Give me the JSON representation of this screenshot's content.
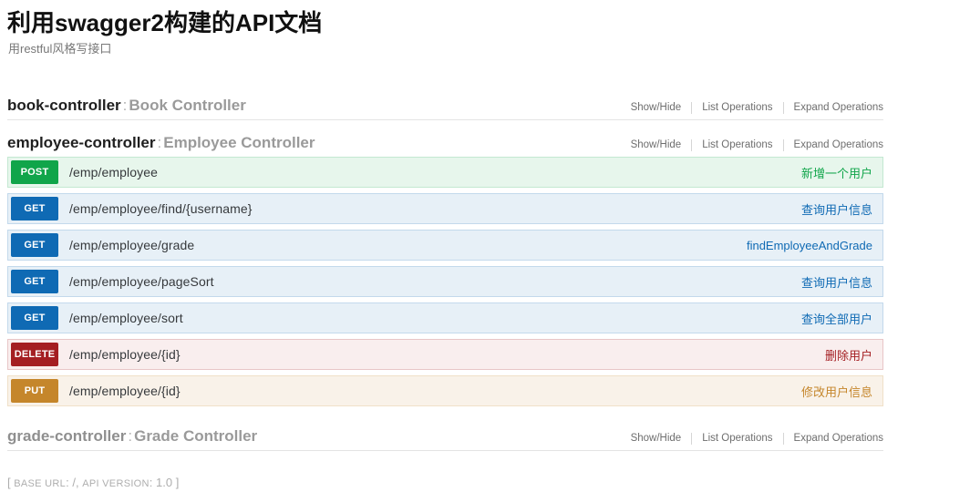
{
  "header": {
    "title": "利用swagger2构建的API文档",
    "subtitle": "用restful风格写接口"
  },
  "options_labels": {
    "show_hide": "Show/Hide",
    "list_operations": "List Operations",
    "expand_operations": "Expand Operations"
  },
  "resources": [
    {
      "name": "book-controller",
      "separator": ":",
      "description": "Book Controller",
      "show_hide": "Show/Hide",
      "list_operations": "List Operations",
      "expand_operations": "Expand Operations",
      "operations": []
    },
    {
      "name": "employee-controller",
      "separator": ":",
      "description": "Employee Controller",
      "show_hide": "Show/Hide",
      "list_operations": "List Operations",
      "expand_operations": "Expand Operations",
      "operations": [
        {
          "method": "POST",
          "path": "/emp/employee",
          "summary": "新增一个用户"
        },
        {
          "method": "GET",
          "path": "/emp/employee/find/{username}",
          "summary": "查询用户信息"
        },
        {
          "method": "GET",
          "path": "/emp/employee/grade",
          "summary": "findEmployeeAndGrade"
        },
        {
          "method": "GET",
          "path": "/emp/employee/pageSort",
          "summary": "查询用户信息"
        },
        {
          "method": "GET",
          "path": "/emp/employee/sort",
          "summary": "查询全部用户"
        },
        {
          "method": "DELETE",
          "path": "/emp/employee/{id}",
          "summary": "删除用户"
        },
        {
          "method": "PUT",
          "path": "/emp/employee/{id}",
          "summary": "修改用户信息"
        }
      ]
    },
    {
      "name": "grade-controller",
      "separator": ":",
      "description": "Grade Controller",
      "show_hide": "Show/Hide",
      "list_operations": "List Operations",
      "expand_operations": "Expand Operations",
      "operations": []
    }
  ],
  "footer": {
    "open_bracket": "[",
    "base_url_label": "BASE URL",
    "base_url_sep": ":",
    "base_url_value": "/",
    "comma": ",",
    "api_version_label": "API VERSION",
    "api_version_sep": ":",
    "api_version_value": "1.0",
    "close_bracket": "]"
  },
  "colors": {
    "post": "#10a54a",
    "get": "#0f6ab4",
    "delete": "#a41e22",
    "put": "#c5862b"
  }
}
